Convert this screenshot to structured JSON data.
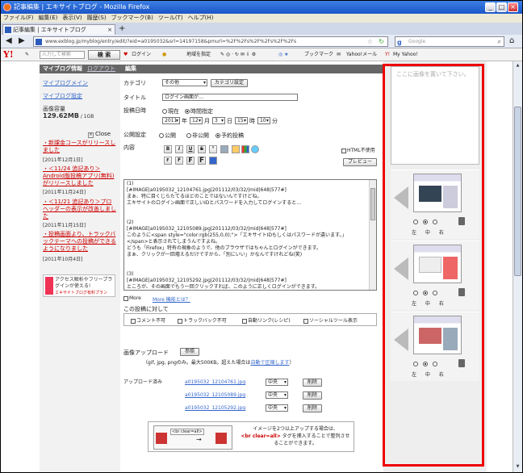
{
  "window": {
    "title": "記事編集 | エキサイトブログ - Mozilla Firefox"
  },
  "menu": [
    "ファイル(F)",
    "編集(E)",
    "表示(V)",
    "履歴(S)",
    "ブックマーク(B)",
    "ツール(T)",
    "ヘルプ(H)"
  ],
  "tab": {
    "label": "記事編集 | エキサイトブログ"
  },
  "nav": {
    "url": "www.exblog.jp/myblog/entry/edit/?eid=a0195032&srl=14197158&pmurl=%2F%2Fs%2F%2Fs%2F%2Fs",
    "search_placeholder": "Google"
  },
  "ybar": {
    "search_placeholder": "入力して検索",
    "search_button": "検 索",
    "login": "ログイン",
    "map": "地域を指定",
    "bookmark": "ブックマーク",
    "mail": "Yahoo!メール",
    "myyahoo": "My Yahoo!"
  },
  "left": {
    "header": "マイブログ情報",
    "header_link": "ログアウト",
    "links": [
      "マイブログメイン",
      "マイブログ設定"
    ],
    "capacity_label": "画像容量",
    "capacity_value": "129.62MB",
    "capacity_total": " / 1GB",
    "close": "Close",
    "news": [
      {
        "title": "・新課金コースがリリースしました",
        "date": "[2011年12月1日]"
      },
      {
        "title": "・＜11/24 追記あり＞Android版投稿アプリ(無料)がリリースしました",
        "date": "[2011年11月24日]"
      },
      {
        "title": "・＜11/21 追記あり＞プロヘッダーの表示が改善しました",
        "date": "[2011年11月15日]"
      },
      {
        "title": "・投稿画面より、トラックバックテーマへの投稿ができるようになりました",
        "date": "[2011年10月4日]"
      }
    ],
    "ad_text": "アクセス解析やフリープラグインが使える!",
    "ad_sub": "エキサイトブログ有料プラン"
  },
  "main": {
    "header": "編集",
    "category_label": "カテゴリ",
    "category_value": "その他",
    "category_button": "カテゴリ設定",
    "title_label": "タイトル",
    "title_value": "ログイン画面が…",
    "post_date_label": "投稿日時",
    "radio_now": "現在",
    "radio_time": "時間指定",
    "year": "2011",
    "year_unit": "年",
    "month": "12",
    "month_unit": "月",
    "day": "3",
    "day_unit": "日",
    "hour": "15",
    "hour_unit": "時",
    "minute": "10",
    "minute_unit": "分",
    "publish_label": "公開設定",
    "publish_public": "公開",
    "publish_private": "非公開",
    "publish_reserved": "予約投稿",
    "content_label": "内容",
    "html_off": "HTML不使用",
    "preview": "プレビュー",
    "toolbar": [
      "B",
      "I",
      "U",
      "S",
      "\"",
      "",
      "",
      "",
      "",
      "F",
      "F",
      "F",
      "F",
      ""
    ],
    "editor_lines": [
      "(1)",
      "[#IMAGE|a0195032_12104761.jpg|201112/03/32/|mid|648|577#]",
      "まぁ、特に目くじらたてるほどのことではないんですけどね。",
      "エキサイトのログイン画面で正しいIDとパスワードを入力してログインすると…",
      "",
      "",
      "(2)",
      "[#IMAGE|a0195032_12105089.jpg|201112/03/32/|mid|648|577#]",
      "このように<span style=\"color:rgb(255,0,0);\">「エキサイトIDもしくはパスワードが違います。」",
      "</span>と表示されてしまうんですよね。",
      "どうも「Firefox」特有の現象のようで、他のブラウザではちゃんとログインができます。",
      "まぁ、クリックが一回増えるだけですから、「別にいい」かなんですけれどね(笑)",
      "",
      "",
      "(3)",
      "[#IMAGE|a0195032_12105292.jpg|201112/03/32/|mid|648|577#]",
      "ところが、その画面でもう一回クリックすれば、このように正しくログインができます。"
    ],
    "more": "More",
    "more_link": "More 機能とは？",
    "post_options_label": "この投稿に対して",
    "options": [
      "コメント不可",
      "トラックバック不可",
      "自動リンク(レシピ)",
      "ソーシャルツール表示"
    ],
    "upload_label": "画像アップロード",
    "upload_button": "参照",
    "upload_note_pre": "（gif, jpg, pngのみ。最大500KB。超えた場合は",
    "upload_note_link": "自動で圧縮します",
    "upload_note_post": "）",
    "uploaded_label": "アップロード済み",
    "uploaded": [
      {
        "file": "a0195032_12104761.jpg",
        "pos": "中央",
        "button": "削除"
      },
      {
        "file": "a0195032_12105089.jpg",
        "pos": "中央",
        "button": "削除"
      },
      {
        "file": "a0195032_12105292.jpg",
        "pos": "中央",
        "button": "削除"
      }
    ],
    "hint_tag": "<br clear=all>",
    "hint_line1": "イメージを2つ以上アップする場合は、",
    "hint_tag_text": "<br clear=all>",
    "hint_line2": " タグを挿入することで整列させることができます。"
  },
  "right": {
    "drop_text": "ここに画像を置いて下さい。",
    "labels": "左 中 右"
  },
  "colors": {
    "titlebar": "#1a55c8",
    "highlight": "#e00000",
    "link": "#3366cc",
    "news": "#cc0000"
  }
}
